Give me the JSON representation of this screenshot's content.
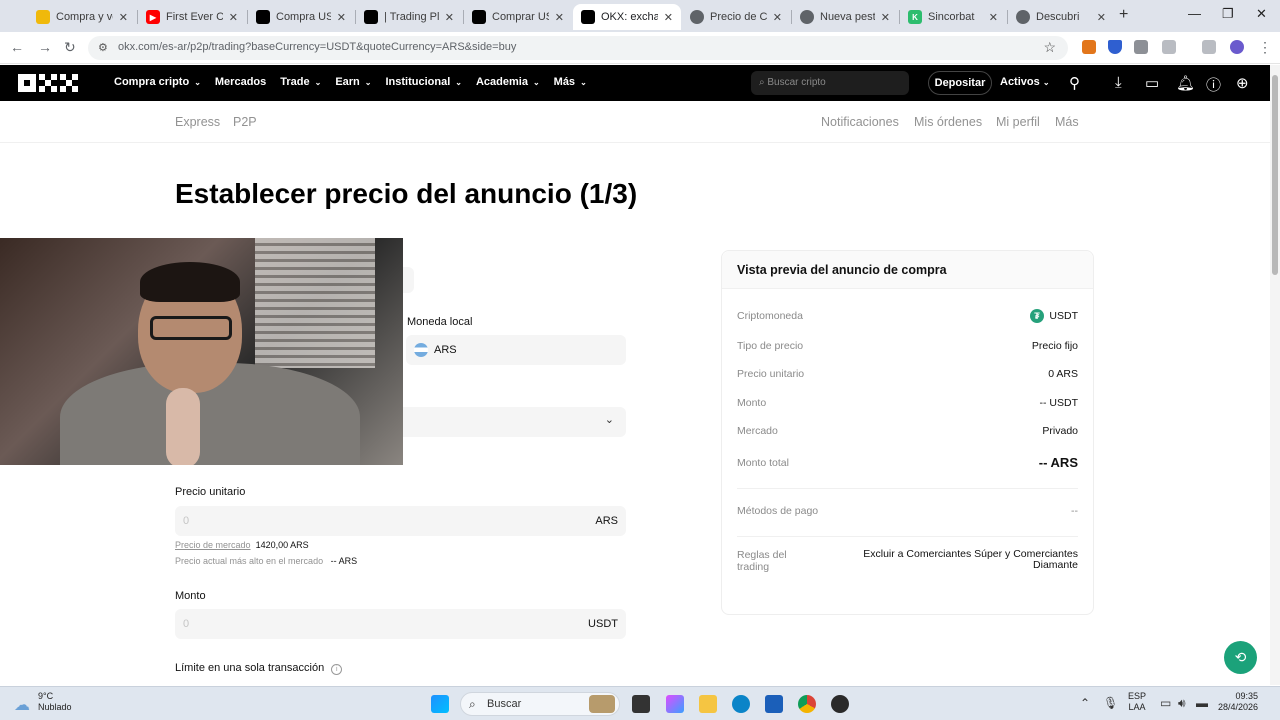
{
  "browser": {
    "tabs": [
      {
        "title": "Compra y ve",
        "color": "#f0b90b"
      },
      {
        "title": "First Ever Cof",
        "color": "#ff0000"
      },
      {
        "title": "Compra USDT",
        "color": "#000000"
      },
      {
        "title": "| Trading Plat",
        "color": "#000000"
      },
      {
        "title": "Comprar USD",
        "color": "#000000"
      },
      {
        "title": "OKX: exchang",
        "color": "#000000"
      },
      {
        "title": "Precio de Crip",
        "color": "#5f6368"
      },
      {
        "title": "Nueva pestañ",
        "color": "#5f6368"
      },
      {
        "title": "Sincorbat",
        "color": "#2dbd6e"
      },
      {
        "title": "Descubri",
        "color": "#5f6368"
      }
    ],
    "url": "okx.com/es-ar/p2p/trading?baseCurrency=USDT&quoteCurrency=ARS&side=buy"
  },
  "header": {
    "nav": [
      {
        "label": "Compra cripto",
        "chevron": true
      },
      {
        "label": "Mercados",
        "chevron": false
      },
      {
        "label": "Trade",
        "chevron": true
      },
      {
        "label": "Earn",
        "chevron": true
      },
      {
        "label": "Institucional",
        "chevron": true
      },
      {
        "label": "Academia",
        "chevron": true
      },
      {
        "label": "Más",
        "chevron": true
      }
    ],
    "search_placeholder": "Buscar cripto",
    "deposit_label": "Depositar",
    "assets_label": "Activos"
  },
  "subnav": {
    "left": [
      "Express",
      "P2P"
    ],
    "right": [
      "Notificaciones",
      "Mis órdenes",
      "Mi perfil",
      "Más"
    ]
  },
  "page_title": "Establecer precio del anuncio (1/3)",
  "form": {
    "local_currency_label": "Moneda local",
    "local_currency_value": "ARS",
    "unit_price_label": "Precio unitario",
    "unit_price_placeholder": "0",
    "unit_price_unit": "ARS",
    "market_price_label": "Precio de mercado",
    "market_price_value": "1420,00 ARS",
    "highest_price_label": "Precio actual más alto en el mercado",
    "highest_price_value": "-- ARS",
    "amount_label": "Monto",
    "amount_placeholder": "0",
    "amount_unit": "USDT",
    "limit_label": "Límite en una sola transacción"
  },
  "preview": {
    "title": "Vista previa del anuncio de compra",
    "rows": [
      {
        "key": "Criptomoneda",
        "value": "USDT"
      },
      {
        "key": "Tipo de precio",
        "value": "Precio fijo"
      },
      {
        "key": "Precio unitario",
        "value": "0 ARS"
      },
      {
        "key": "Monto",
        "value": "-- USDT"
      },
      {
        "key": "Mercado",
        "value": "Privado"
      },
      {
        "key": "Monto total",
        "value": "-- ARS"
      },
      {
        "key": "Métodos de pago",
        "value": "--"
      },
      {
        "key": "Reglas del trading",
        "value": "Excluir a Comerciantes Súper y Comerciantes Diamante"
      }
    ]
  },
  "taskbar": {
    "temperature": "9°C",
    "weather": "Nublado",
    "search_label": "Buscar",
    "lang_1": "ESP",
    "lang_2": "LAA",
    "time": "09:35",
    "date": "28/4/2026"
  },
  "colors": {
    "accent_green": "#1ba27a",
    "usdt_green": "#26a17b",
    "header_bg": "#000000"
  }
}
